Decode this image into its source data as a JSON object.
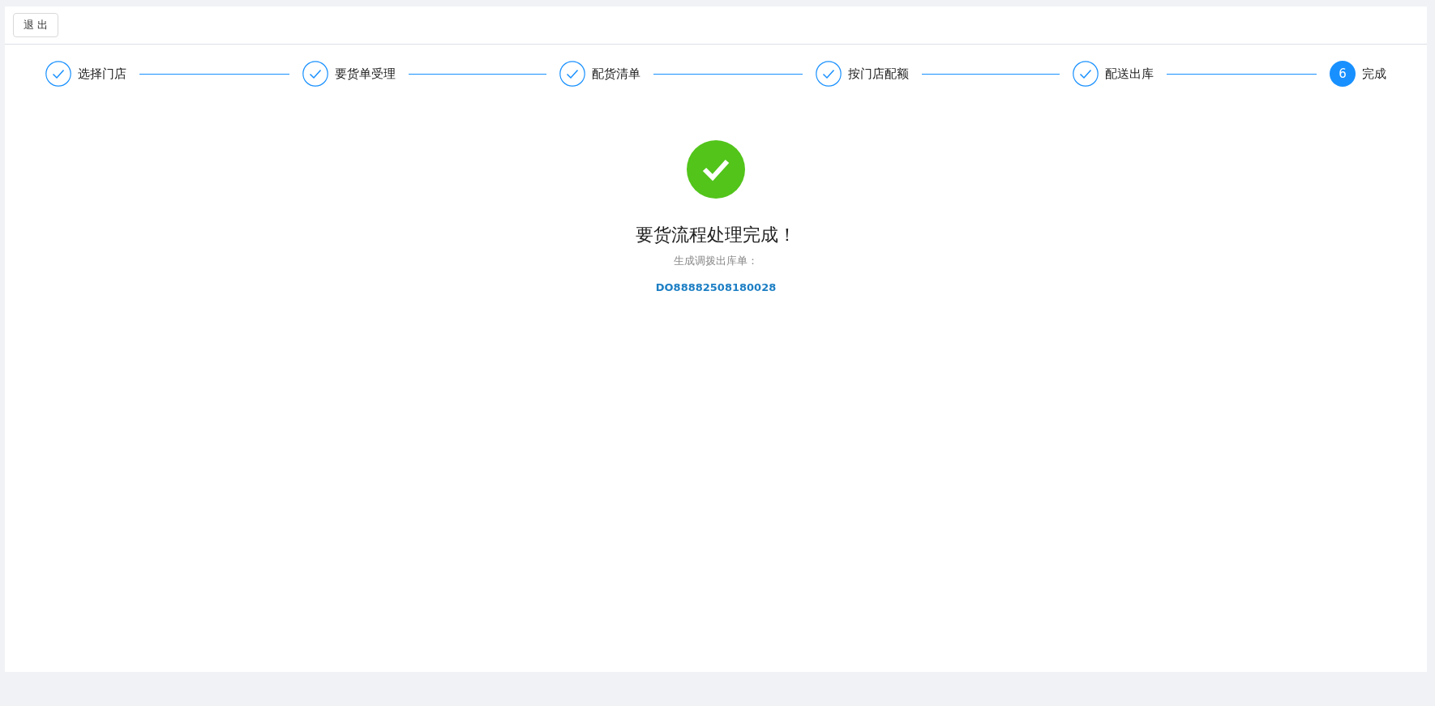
{
  "toolbar": {
    "exit_button": "退 出"
  },
  "steps": [
    {
      "label": "选择门店",
      "done": true
    },
    {
      "label": "要货单受理",
      "done": true
    },
    {
      "label": "配货清单",
      "done": true
    },
    {
      "label": "按门店配额",
      "done": true
    },
    {
      "label": "配送出库",
      "done": true
    },
    {
      "label": "完成",
      "done": false,
      "number": "6"
    }
  ],
  "result": {
    "success": true,
    "title": "要货流程处理完成！",
    "subtitle": "生成调拨出库单：",
    "document_number": "DO88882508180028"
  }
}
